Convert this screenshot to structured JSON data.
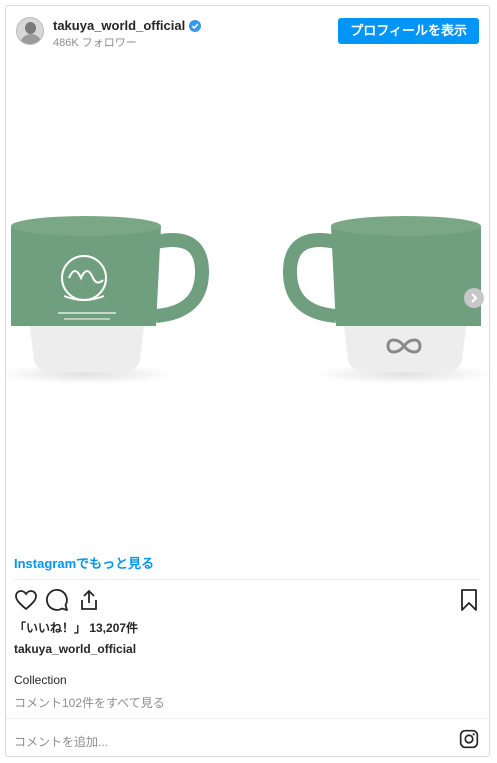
{
  "header": {
    "username": "takuya_world_official",
    "followers": "486K フォロワー",
    "profile_button": "プロフィールを表示"
  },
  "media": {
    "left_mug_logo_text": "HOW TO CREATE",
    "colors": {
      "mug_green": "#6f9f7e",
      "mug_base": "#ededed"
    }
  },
  "link": {
    "instagram_more": "Instagramでもっと見る"
  },
  "actions": {
    "icons": [
      "heart-icon",
      "comment-icon",
      "share-icon",
      "bookmark-icon"
    ]
  },
  "post": {
    "likes": "「いいね！」 13,207件",
    "owner": "takuya_world_official",
    "caption": "Collection",
    "view_comments": "コメント102件をすべて見る"
  },
  "comment_box": {
    "placeholder": "コメントを追加..."
  },
  "colors": {
    "accent": "#0095f6",
    "text": "#262626",
    "muted": "#8e8e8e"
  }
}
